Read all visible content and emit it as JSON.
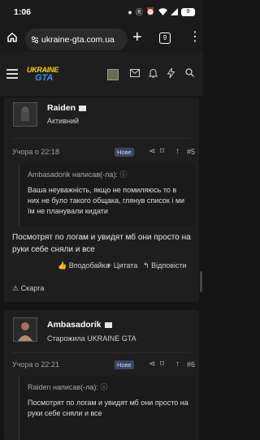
{
  "status_bar": {
    "time": "1:06",
    "icons": [
      "dot-icon",
      "r-icon",
      "alarm-icon",
      "wifi-icon",
      "signal-icon",
      "battery-icon"
    ],
    "battery": "9"
  },
  "browser": {
    "url": "ukraine-gta.com.ua",
    "tabs_count": "9"
  },
  "site": {
    "logo_top": "UKRAINE",
    "logo_bottom": "GTA"
  },
  "posts": [
    {
      "author": "Raiden",
      "role": "Активний",
      "time": "Учора о 22:18",
      "badge": "Нове",
      "number": "#5",
      "quote_head": "Ambasadorik написав(-ла):",
      "quote_body": "Ваша неуважність, якщо не помиляюсь то в них не було такого общака, глянув список і ми їм не планували кидати",
      "message": "Посмотрят по логам и увидят мб они просто на руки себе сняли и все",
      "actions": {
        "like": "Вподобайка",
        "quote": "Цитата",
        "reply": "Відповісти",
        "report": "Скарга"
      }
    },
    {
      "author": "Ambasadorik",
      "role": "Старожила UKRAINE GTA",
      "time": "Учора о 22:21",
      "badge": "Нове",
      "number": "#6",
      "quote_head": "Raiden написав(-ла):",
      "quote_body": "Посмотрят по логам и увидят мб они просто на руки себе сняли и все"
    }
  ],
  "colors": {
    "background": "#141414",
    "card": "#1e1e1e",
    "logo_yellow": "#ffd500",
    "logo_blue": "#3c8cff",
    "badge": "#3a4660"
  }
}
